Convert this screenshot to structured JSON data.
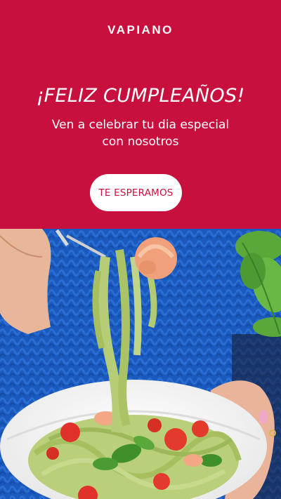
{
  "brand": {
    "logo_text": "VAPIANO",
    "primary_color": "#c8103e",
    "background_photo_color": "#1f63c7"
  },
  "hero": {
    "headline": "¡FELIZ CUMPLEAÑOS!",
    "subline_line1": "Ven a celebrar tu dia especial",
    "subline_line2": "con nosotros",
    "cta_label": "TE ESPERAMOS"
  },
  "photo": {
    "icon": "pasta-bowl-photo"
  }
}
